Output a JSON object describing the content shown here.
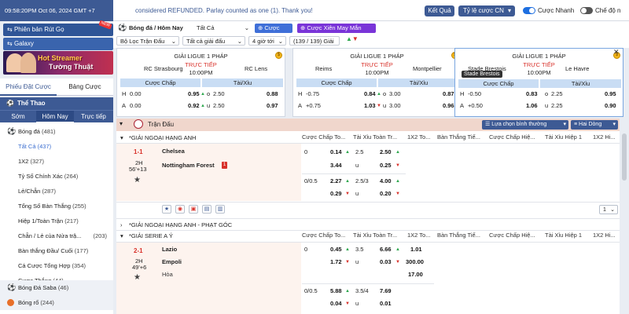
{
  "topbar": {
    "time": "09:58:20PM Oct 06, 2024 GMT +7",
    "marquee": "considered REFUNDED. Parlay counted as one (1). Thank you!",
    "result_btn": "Kết Quả",
    "odds_select": "Tỷ lệ cược CN",
    "quick_bet_label": "Cược Nhanh",
    "mode_label": "Chế độ n"
  },
  "left": {
    "banner1": "Phiên bản Rút Gọ",
    "banner1_badge": "NEW",
    "banner2": "Galaxy",
    "promo_title": "Hot Streamer",
    "promo_sub": "Tường Thuật",
    "tab_slip": "Phiếu Đặt Cược",
    "tab_table": "Bảng Cược",
    "sport_head": "Thể Thao",
    "subtabs": [
      "Sớm",
      "Hôm Nay",
      "Trực tiếp"
    ],
    "items": [
      {
        "label": "Bóng đá",
        "count": "(481)"
      },
      {
        "label": "Tất Cả",
        "count": "(437)"
      },
      {
        "label": "1X2",
        "count": "(327)"
      },
      {
        "label": "Tỷ Số Chính Xác",
        "count": "(264)"
      },
      {
        "label": "Lẻ/Chẵn",
        "count": "(287)"
      },
      {
        "label": "Tổng Số Bàn Thắng",
        "count": "(255)"
      },
      {
        "label": "Hiệp 1/Toàn Trận",
        "count": "(217)"
      },
      {
        "label": "Chẵn / Lẻ của Nửa trậ...",
        "count": "(203)"
      },
      {
        "label": "Bàn thắng Đầu/ Cuối",
        "count": "(177)"
      },
      {
        "label": "Cá Cược Tổng Hợp",
        "count": "(354)"
      },
      {
        "label": "Cược Thắng",
        "count": "(44)"
      },
      {
        "label": "Bóng Đá Saba",
        "count": "(46)"
      },
      {
        "label": "Bóng rổ",
        "count": "(244)"
      }
    ]
  },
  "controls": {
    "breadcrumb": "Bóng đá / Hôm Nay",
    "filter_all": "Tất Cả",
    "parlay": "Cược Xiên",
    "lucky_parlay": "Cược Xiên May Mắn",
    "filter_match": "Bộ Lọc Trận Đấu",
    "all_leagues": "Tất cả giải đấu",
    "hours": "4 giờ tới",
    "league_count": "(139 / 139) Giải"
  },
  "cards": [
    {
      "league": "GIẢI LIGUE 1 PHÁP",
      "home": "RC Strasbourg",
      "away": "RC Lens",
      "live": "TRỰC TIẾP",
      "time": "10:00PM",
      "hcap_label": "Cược Chấp",
      "ou_label": "Tài/Xỉu",
      "rows": [
        {
          "side": "H",
          "line": "0.00",
          "odd": "0.95",
          "dir": "up",
          "ou_side": "o",
          "ou_line": "2.50",
          "ou_odd": "0.88"
        },
        {
          "side": "A",
          "line": "0.00",
          "odd": "0.92",
          "dir": "up",
          "ou_side": "u",
          "ou_line": "2.50",
          "ou_odd": "0.97"
        }
      ]
    },
    {
      "league": "GIẢI LIGUE 1 PHÁP",
      "home": "Reims",
      "away": "Montpellier",
      "live": "TRỰC TIẾP",
      "time": "10:00PM",
      "hcap_label": "Cược Chấp",
      "ou_label": "Tài/Xỉu",
      "rows": [
        {
          "side": "H",
          "line": "-0.75",
          "odd": "0.84",
          "dir": "up",
          "ou_side": "o",
          "ou_line": "3.00",
          "ou_odd": "0.87"
        },
        {
          "side": "A",
          "line": "+0.75",
          "odd": "1.03",
          "dir": "dn",
          "ou_side": "u",
          "ou_line": "3.00",
          "ou_odd": "0.96"
        }
      ]
    },
    {
      "league": "GIẢI LIGUE 1 PHÁP",
      "home": "Stade Brestois",
      "away": "Le Havre",
      "live": "TRỰC TIẾP",
      "time": "10:00PM",
      "tooltip": "Stade Brestois",
      "hcap_label": "Cược Chấp",
      "ou_label": "Tài/Xỉu",
      "rows": [
        {
          "side": "H",
          "line": "-0.50",
          "odd": "0.83",
          "dir": "",
          "ou_side": "o",
          "ou_line": "2.25",
          "ou_odd": "0.95"
        },
        {
          "side": "A",
          "line": "+0.50",
          "odd": "1.06",
          "dir": "",
          "ou_side": "u",
          "ou_line": "2.25",
          "ou_odd": "0.90"
        }
      ]
    }
  ],
  "main": {
    "section_title": "Trận Đấu",
    "sort_label": "Lựa chọn bình thường",
    "lines_label": "Hai Dòng",
    "columns": [
      "Cược Chấp To...",
      "Tài Xỉu Toàn Tr...",
      "1X2 To...",
      "Bàn Thắng Tiế...",
      "Cược Chấp Hiệ...",
      "Tài Xỉu Hiệp 1",
      "1X2 Hi..."
    ],
    "league1": "*GIẢI NGOẠI HẠNG ANH",
    "match1": {
      "score": "1-1",
      "period": "2H",
      "clock": "56'+13",
      "home": "Chelsea",
      "away": "Nottingham Forest",
      "red": "1",
      "rows": [
        {
          "hl": "0",
          "ho": "0.14",
          "hd": "up",
          "ol": "2.5",
          "oo": "2.50",
          "od": "up"
        },
        {
          "hl": "",
          "ho": "3.44",
          "hd": "",
          "ol": "u",
          "oo": "0.25",
          "od": "dn"
        },
        {
          "hl": "0/0.5",
          "ho": "2.27",
          "hd": "up",
          "ol": "2.5/3",
          "oo": "4.00",
          "od": "up"
        },
        {
          "hl": "",
          "ho": "0.29",
          "hd": "dn",
          "ol": "u",
          "oo": "0.20",
          "od": "dn"
        }
      ],
      "page": "1"
    },
    "league2": "*GIẢI NGOẠI HẠNG ANH - PHẠT GÓC",
    "league3": "*GIẢI SERIE A Ý",
    "match2": {
      "score": "2-1",
      "period": "2H",
      "clock": "49'+6",
      "home": "Lazio",
      "away": "Empoli",
      "draw": "Hòa",
      "rows": [
        {
          "hl": "0",
          "ho": "0.45",
          "hd": "up",
          "ol": "3.5",
          "oo": "6.66",
          "od": "up",
          "x": "1.01"
        },
        {
          "hl": "",
          "ho": "1.72",
          "hd": "dn",
          "ol": "u",
          "oo": "0.03",
          "od": "dn",
          "x": "300.00"
        },
        {
          "hl": "",
          "ho": "",
          "hd": "",
          "ol": "",
          "oo": "",
          "od": "",
          "x": "17.00"
        },
        {
          "hl": "0/0.5",
          "ho": "5.88",
          "hd": "up",
          "ol": "3.5/4",
          "oo": "7.69",
          "od": "",
          "x": ""
        },
        {
          "hl": "",
          "ho": "0.04",
          "hd": "dn",
          "ol": "u",
          "oo": "0.01",
          "od": "",
          "x": ""
        }
      ]
    }
  }
}
